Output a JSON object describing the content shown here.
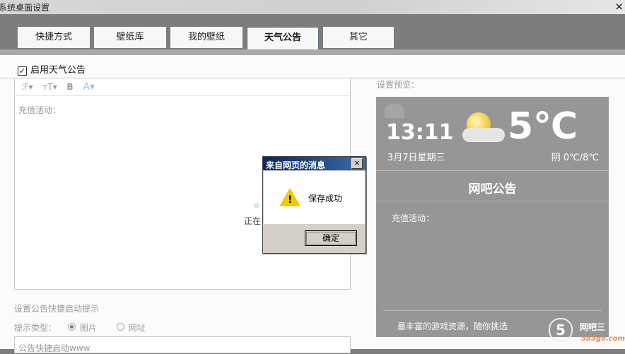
{
  "window": {
    "title": "系统桌面设置",
    "close_label": "×"
  },
  "tabs": [
    {
      "label": "快捷方式"
    },
    {
      "label": "壁纸库"
    },
    {
      "label": "我的壁纸"
    },
    {
      "label": "天气公告",
      "active": true
    },
    {
      "label": "其它"
    }
  ],
  "settings": {
    "enable_label": "启用天气公告",
    "enable_checked": true,
    "editor_toolbar": [
      "ℱ▾",
      "тT▾",
      "B",
      "A▾"
    ],
    "editor_text": "充值活动：",
    "saving_text": "正在",
    "shortcut_title": "设置公告快捷启动提示",
    "hint_label": "提示类型：",
    "hint_options": [
      "图片",
      "网址"
    ],
    "shortcut_input": "公告快捷启动www"
  },
  "preview": {
    "label": "设置预览：",
    "time": "13:11",
    "date": "3月7日星期三",
    "temperature": "5℃",
    "weather_desc": "阴  0℃/8℃",
    "notice_title": "网吧公告",
    "notice_text": "充值活动：",
    "footer": "最丰富的游戏资源，随你挑选",
    "logo_glyph": "5",
    "logo_text": "网吧三",
    "logo_url": "583go.com"
  },
  "dialog": {
    "title": "来自网页的消息",
    "close_label": "×",
    "icon": "warning-icon",
    "message": "保存成功",
    "ok_label": "确定"
  }
}
